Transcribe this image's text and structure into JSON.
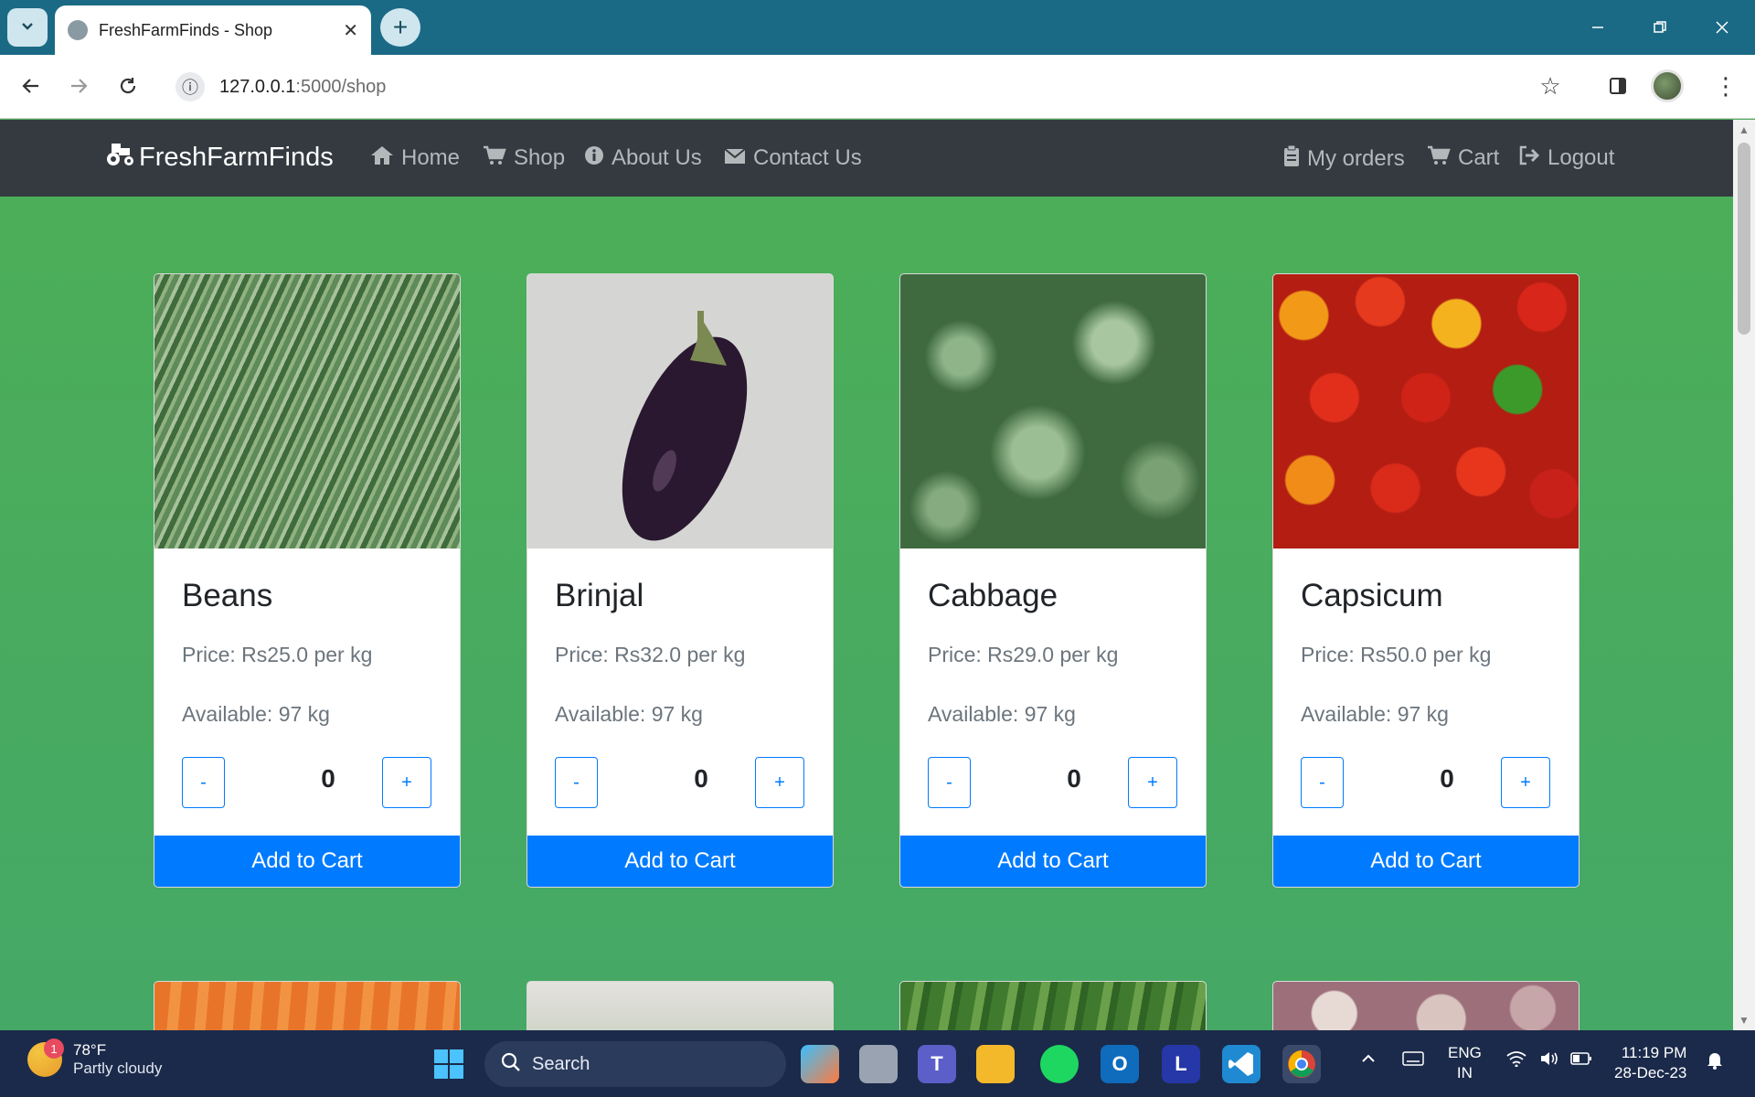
{
  "browser": {
    "tab_title": "FreshFarmFinds - Shop",
    "tab_close": "✕",
    "new_tab": "+",
    "url_host": "127.0.0.1",
    "url_rest": ":5000/shop",
    "icons": [
      "chevron-down-icon",
      "globe-icon",
      "back-icon",
      "forward-icon",
      "reload-icon",
      "info-icon",
      "star-icon",
      "sidebar-icon",
      "more-icon"
    ]
  },
  "navbar": {
    "brand": "FreshFarmFinds",
    "links": [
      {
        "label": "Home",
        "icon": "home-icon"
      },
      {
        "label": "Shop",
        "icon": "cart-icon"
      },
      {
        "label": "About Us",
        "icon": "info-circle-icon"
      },
      {
        "label": "Contact Us",
        "icon": "envelope-icon"
      }
    ],
    "right_links": [
      {
        "label": "My orders",
        "icon": "clipboard-icon"
      },
      {
        "label": "Cart",
        "icon": "cart-icon"
      },
      {
        "label": "Logout",
        "icon": "logout-icon"
      }
    ]
  },
  "products": [
    {
      "name": "Beans",
      "price": "Price: Rs25.0 per kg",
      "available": "Available: 97 kg",
      "qty": "0",
      "minus": "-",
      "plus": "+",
      "add": "Add to Cart"
    },
    {
      "name": "Brinjal",
      "price": "Price: Rs32.0 per kg",
      "available": "Available: 97 kg",
      "qty": "0",
      "minus": "-",
      "plus": "+",
      "add": "Add to Cart"
    },
    {
      "name": "Cabbage",
      "price": "Price: Rs29.0 per kg",
      "available": "Available: 97 kg",
      "qty": "0",
      "minus": "-",
      "plus": "+",
      "add": "Add to Cart"
    },
    {
      "name": "Capsicum",
      "price": "Price: Rs50.0 per kg",
      "available": "Available: 97 kg",
      "qty": "0",
      "minus": "-",
      "plus": "+",
      "add": "Add to Cart"
    }
  ],
  "taskbar": {
    "weather_temp": "78°F",
    "weather_desc": "Partly cloudy",
    "weather_badge": "1",
    "search_label": "Search",
    "lang_line1": "ENG",
    "lang_line2": "IN",
    "time": "11:19 PM",
    "date": "28-Dec-23"
  },
  "colors": {
    "tabbar": "#1a6a85",
    "navbar": "#343a40",
    "page_bg": "#4cae58",
    "primary": "#007bff",
    "taskbar": "#1b2a4a"
  }
}
